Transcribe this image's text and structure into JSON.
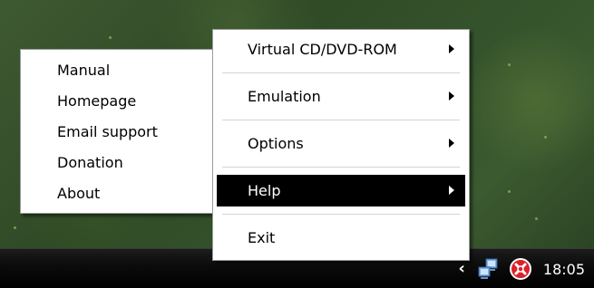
{
  "tray_menu": {
    "items": [
      {
        "label": "Virtual CD/DVD-ROM",
        "has_submenu": true
      },
      {
        "label": "Emulation",
        "has_submenu": true
      },
      {
        "label": "Options",
        "has_submenu": true
      },
      {
        "label": "Help",
        "has_submenu": true,
        "active": true
      },
      {
        "label": "Exit",
        "has_submenu": false
      }
    ]
  },
  "help_submenu": {
    "items": [
      {
        "label": "Manual"
      },
      {
        "label": "Homepage"
      },
      {
        "label": "Email support"
      },
      {
        "label": "Donation"
      },
      {
        "label": "About"
      }
    ]
  },
  "taskbar": {
    "clock": "18:05",
    "icons": [
      "show-hidden-icons-chevron",
      "network-icon",
      "daemon-tools-icon"
    ]
  },
  "colors": {
    "highlight_bg": "#000000",
    "highlight_fg": "#ffffff",
    "taskbar_bg": "#000000",
    "daemon_icon_red": "#d9232a"
  }
}
